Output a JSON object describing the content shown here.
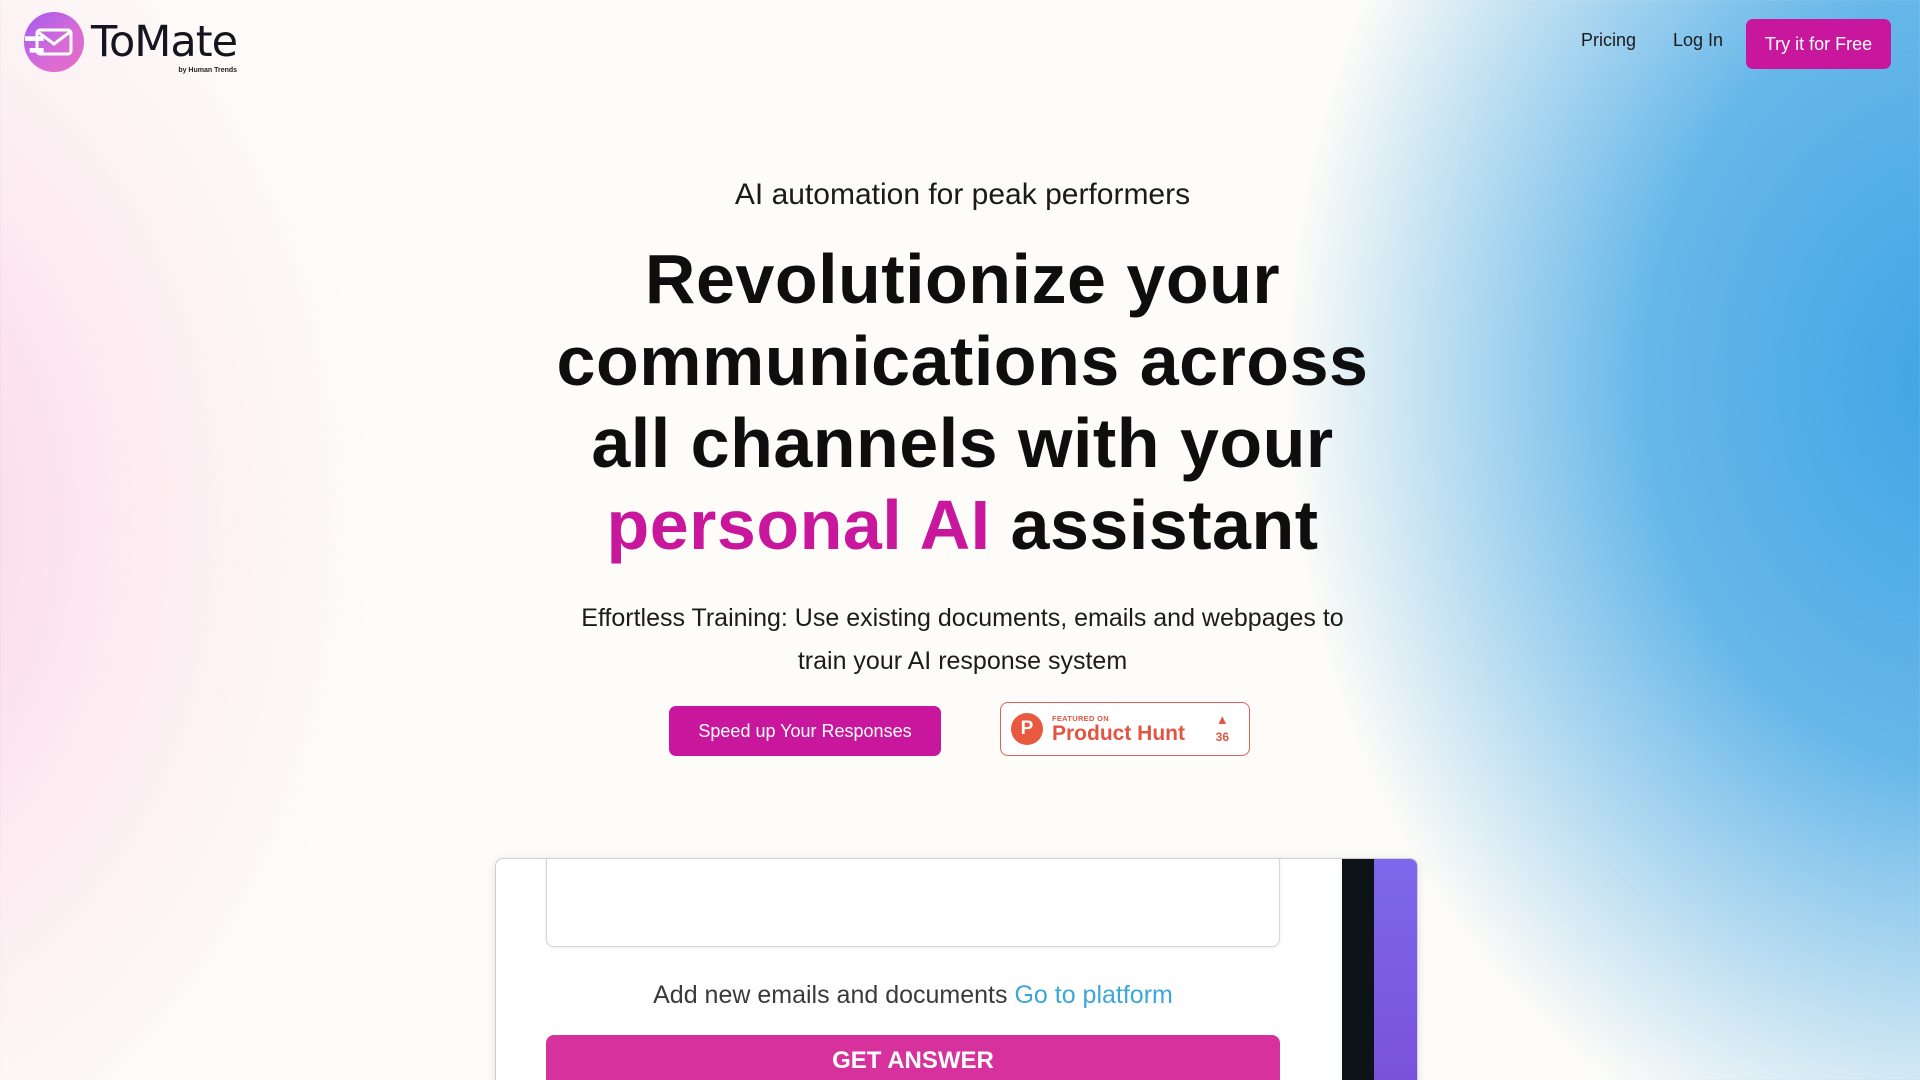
{
  "brand": {
    "name": "ToMate",
    "tagline": "by Human Trends",
    "accent_color": "#c8169d",
    "icon": "envelope-icon"
  },
  "nav": {
    "links": [
      {
        "label": "Pricing"
      },
      {
        "label": "Log In"
      }
    ],
    "cta_label": "Try it for Free"
  },
  "hero": {
    "eyebrow": "AI automation for peak performers",
    "headline_part1": "Revolutionize your communications across all channels with your",
    "headline_accent": "personal AI",
    "headline_part2": "assistant",
    "subtext": "Effortless Training: Use existing documents, emails and webpages to train your AI response system",
    "primary_button": "Speed up Your Responses"
  },
  "product_hunt": {
    "logo_letter": "P",
    "featured_label": "FEATURED ON",
    "name": "Product Hunt",
    "upvote_icon": "triangle-up-icon",
    "upvotes": "36",
    "color": "#e25542"
  },
  "demo": {
    "caption": "Add new emails and documents",
    "link_label": "Go to platform",
    "button_label": "GET ANSWER"
  }
}
